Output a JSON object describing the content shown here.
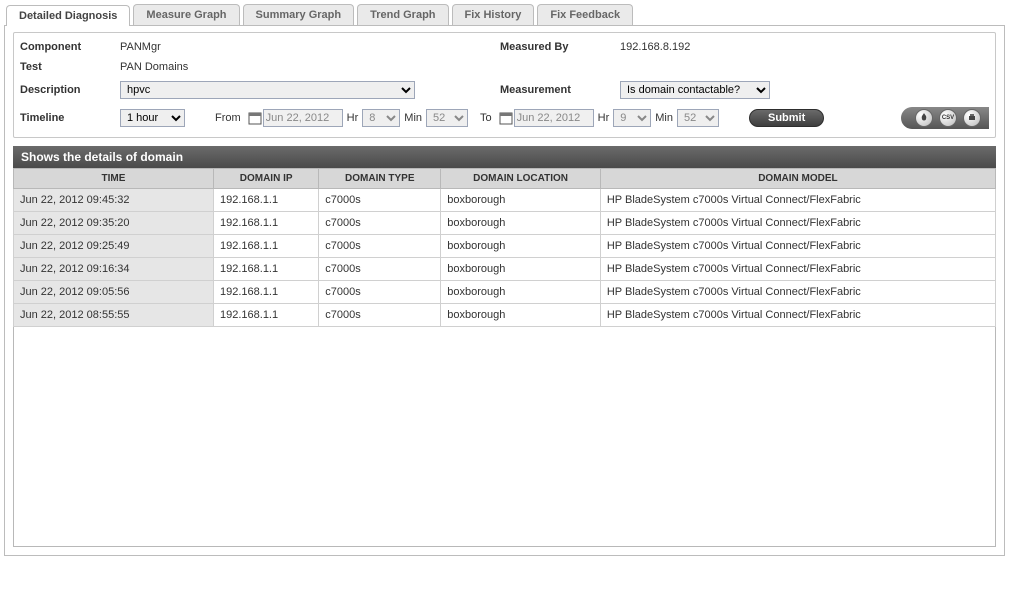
{
  "tabs": [
    {
      "label": "Detailed Diagnosis",
      "active": true
    },
    {
      "label": "Measure Graph",
      "active": false
    },
    {
      "label": "Summary Graph",
      "active": false
    },
    {
      "label": "Trend Graph",
      "active": false
    },
    {
      "label": "Fix History",
      "active": false
    },
    {
      "label": "Fix Feedback",
      "active": false
    }
  ],
  "filters": {
    "component_label": "Component",
    "component_value": "PANMgr",
    "measured_by_label": "Measured By",
    "measured_by_value": "192.168.8.192",
    "test_label": "Test",
    "test_value": "PAN Domains",
    "description_label": "Description",
    "description_value": "hpvc",
    "measurement_label": "Measurement",
    "measurement_value": "Is domain contactable?",
    "timeline_label": "Timeline",
    "timeline_value": "1 hour",
    "from_label": "From",
    "from_date": "Jun 22, 2012",
    "from_hr_label": "Hr",
    "from_hr": "8",
    "from_min_label": "Min",
    "from_min": "52",
    "to_label": "To",
    "to_date": "Jun 22, 2012",
    "to_hr_label": "Hr",
    "to_hr": "9",
    "to_min_label": "Min",
    "to_min": "52",
    "submit_label": "Submit"
  },
  "section_title": "Shows the details of domain",
  "table": {
    "columns": [
      "TIME",
      "DOMAIN IP",
      "DOMAIN TYPE",
      "DOMAIN LOCATION",
      "DOMAIN MODEL"
    ],
    "rows": [
      [
        "Jun 22, 2012 09:45:32",
        "192.168.1.1",
        "c7000s",
        "boxborough",
        "HP BladeSystem c7000s Virtual Connect/FlexFabric"
      ],
      [
        "Jun 22, 2012 09:35:20",
        "192.168.1.1",
        "c7000s",
        "boxborough",
        "HP BladeSystem c7000s Virtual Connect/FlexFabric"
      ],
      [
        "Jun 22, 2012 09:25:49",
        "192.168.1.1",
        "c7000s",
        "boxborough",
        "HP BladeSystem c7000s Virtual Connect/FlexFabric"
      ],
      [
        "Jun 22, 2012 09:16:34",
        "192.168.1.1",
        "c7000s",
        "boxborough",
        "HP BladeSystem c7000s Virtual Connect/FlexFabric"
      ],
      [
        "Jun 22, 2012 09:05:56",
        "192.168.1.1",
        "c7000s",
        "boxborough",
        "HP BladeSystem c7000s Virtual Connect/FlexFabric"
      ],
      [
        "Jun 22, 2012 08:55:55",
        "192.168.1.1",
        "c7000s",
        "boxborough",
        "HP BladeSystem c7000s Virtual Connect/FlexFabric"
      ]
    ]
  },
  "toolbar_icons": {
    "flame": "flame-icon",
    "csv": "CSV",
    "print": "print-icon"
  }
}
